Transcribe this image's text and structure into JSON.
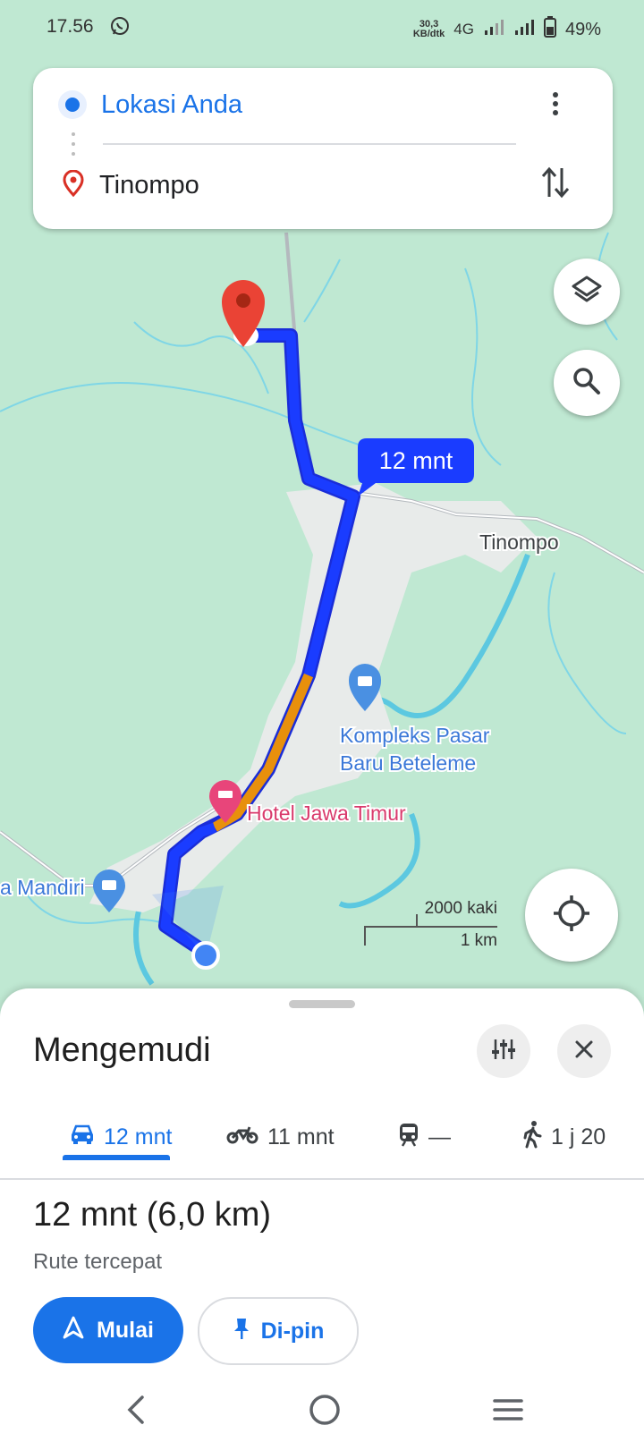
{
  "status_bar": {
    "time": "17.56",
    "net_speed_top": "30,3",
    "net_speed_bottom": "KB/dtk",
    "network": "4G",
    "battery": "49%"
  },
  "directions_card": {
    "origin": "Lokasi Anda",
    "destination": "Tinompo"
  },
  "map": {
    "route_label": "12 mnt",
    "place_tinompo": "Tinompo",
    "place_market_line1": "Kompleks Pasar",
    "place_market_line2": "Baru Beteleme",
    "place_hotel": "Hotel Jawa Timur",
    "place_mandiri": "a Mandiri",
    "scale_imperial": "2000 kaki",
    "scale_metric": "1 km",
    "colors": {
      "route": "#1a3cff",
      "traffic": "#e8900c",
      "pin": "#ea4335",
      "hotel": "#e8457a",
      "shop": "#4a90e2"
    }
  },
  "sheet": {
    "title": "Mengemudi",
    "tabs": [
      {
        "icon": "car-icon",
        "label": "12 mnt"
      },
      {
        "icon": "motorcycle-icon",
        "label": "11 mnt"
      },
      {
        "icon": "train-icon",
        "label": "—"
      },
      {
        "icon": "walk-icon",
        "label": "1 j 20"
      }
    ],
    "summary": "12 mnt (6,0 km)",
    "subtitle": "Rute tercepat",
    "start_label": "Mulai",
    "pin_label": "Di-pin"
  }
}
